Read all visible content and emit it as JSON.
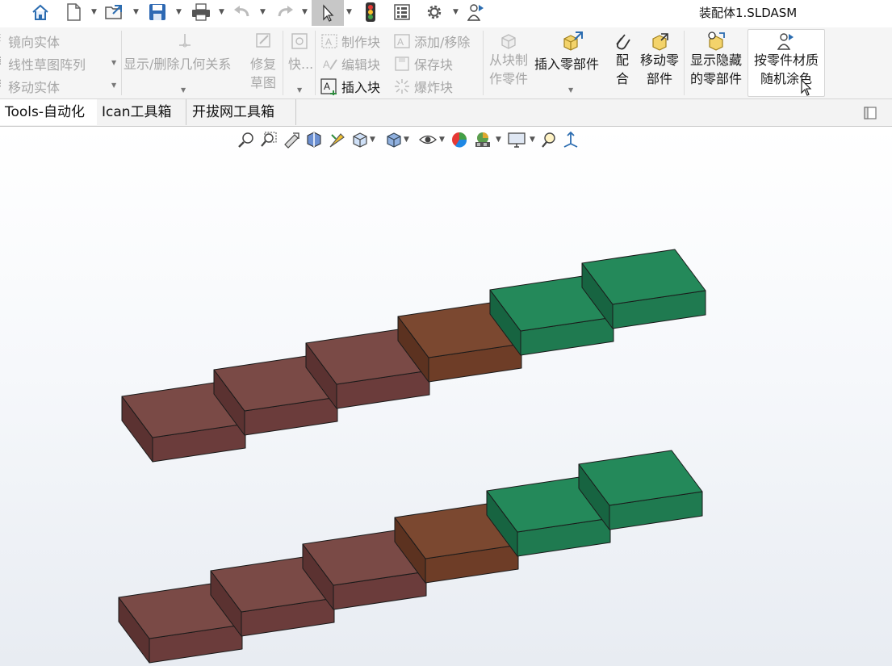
{
  "window": {
    "title": "装配体1.SLDASM"
  },
  "quick_access": {
    "icons": [
      "home-icon",
      "new-document-icon",
      "open-icon",
      "save-icon",
      "print-icon",
      "undo-icon",
      "redo-icon",
      "select-arrow-icon",
      "rebuild-traffic-light-icon",
      "options-list-icon",
      "settings-gear-icon",
      "user-arrow-icon"
    ]
  },
  "ribbon": {
    "left_block": {
      "mirror_entities": "镜向实体",
      "linear_sketch_pattern": "线性草图阵列",
      "move_entities": "移动实体"
    },
    "show_delete_relations": "显示/删除几何关系",
    "repair_sketch": {
      "line1": "修复",
      "line2": "草图"
    },
    "quick_snap": "快...",
    "blocks": {
      "make_block": "制作块",
      "edit_block": "编辑块",
      "insert_block": "插入块",
      "add_remove": "添加/移除",
      "save_block": "保存块",
      "explode_block": "爆炸块"
    },
    "make_part_from_block": {
      "line1": "从块制",
      "line2": "作零件"
    },
    "insert_components": "插入零部件",
    "mate": {
      "line1": "配",
      "line2": "合"
    },
    "move_component": {
      "line1": "移动零",
      "line2": "部件"
    },
    "show_hidden_components": {
      "line1": "显示隐藏",
      "line2": "的零部件"
    },
    "random_color_by_material": {
      "line1": "按零件材质",
      "line2": "随机涂色"
    }
  },
  "tabs": [
    {
      "label": "Tools-自动化"
    },
    {
      "label": "Ican工具箱"
    },
    {
      "label": "开拔网工具箱"
    }
  ],
  "viewport": {
    "hud_icons": [
      "zoom-to-fit-icon",
      "zoom-to-area-icon",
      "previous-view-icon",
      "section-view-icon",
      "dynamic-annotation-icon",
      "view-orientation-icon",
      "display-style-icon",
      "hide-show-items-icon",
      "edit-appearance-icon",
      "apply-scene-icon",
      "view-settings-icon",
      "rotate-icon",
      "move-icon"
    ],
    "colors": {
      "brown_red_top": "#7a4a46",
      "orange_brown_top": "#7b4830",
      "green_top": "#24895a"
    },
    "rows": [
      {
        "blocks": [
          "brown-red",
          "brown-red",
          "brown-red",
          "orange-brown",
          "green",
          "green"
        ]
      },
      {
        "blocks": [
          "brown-red",
          "brown-red",
          "brown-red",
          "orange-brown",
          "green",
          "green"
        ]
      }
    ]
  }
}
